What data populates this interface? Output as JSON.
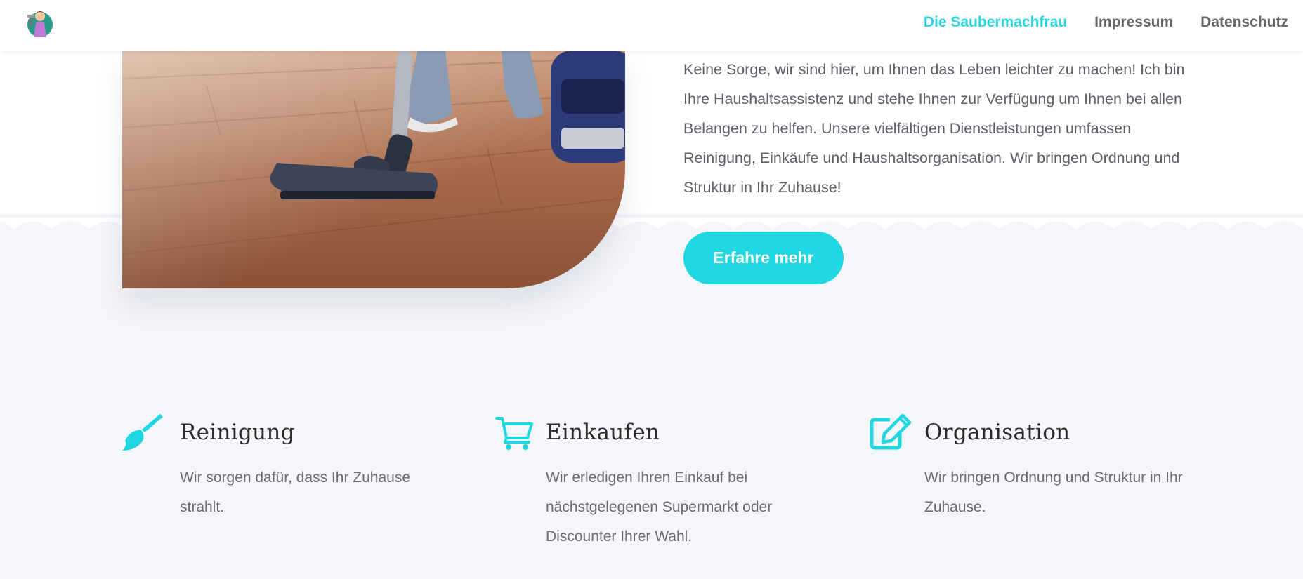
{
  "header": {
    "nav": [
      {
        "label": "Die Saubermachfrau",
        "active": true
      },
      {
        "label": "Impressum",
        "active": false
      },
      {
        "label": "Datenschutz",
        "active": false
      }
    ]
  },
  "hero": {
    "text": "Keine Sorge, wir sind hier, um Ihnen das Leben leichter zu machen! Ich bin Ihre Haushaltsassistenz und stehe Ihnen zur Verfügung um Ihnen bei allen Belangen zu helfen. Unsere vielfältigen Dienstleistungen umfassen Reinigung, Einkäufe  und Haushaltsorganisation. Wir bringen Ordnung und Struktur in Ihr Zuhause!",
    "cta_label": "Erfahre mehr"
  },
  "features": [
    {
      "icon": "broom-icon",
      "title": "Reinigung",
      "text": "Wir sorgen dafür, dass Ihr Zuhause strahlt."
    },
    {
      "icon": "shopping-cart-icon",
      "title": "Einkaufen",
      "text": "Wir erledigen Ihren Einkauf bei nächstgelegenen Supermarkt oder Discounter Ihrer Wahl."
    },
    {
      "icon": "edit-icon",
      "title": "Organisation",
      "text": "Wir bringen Ordnung und Struktur in Ihr Zuhause."
    }
  ],
  "colors": {
    "accent": "#20d6e0",
    "section_bg": "#f5f6fa",
    "heading": "#2b2b2b",
    "body_text": "#666666"
  }
}
